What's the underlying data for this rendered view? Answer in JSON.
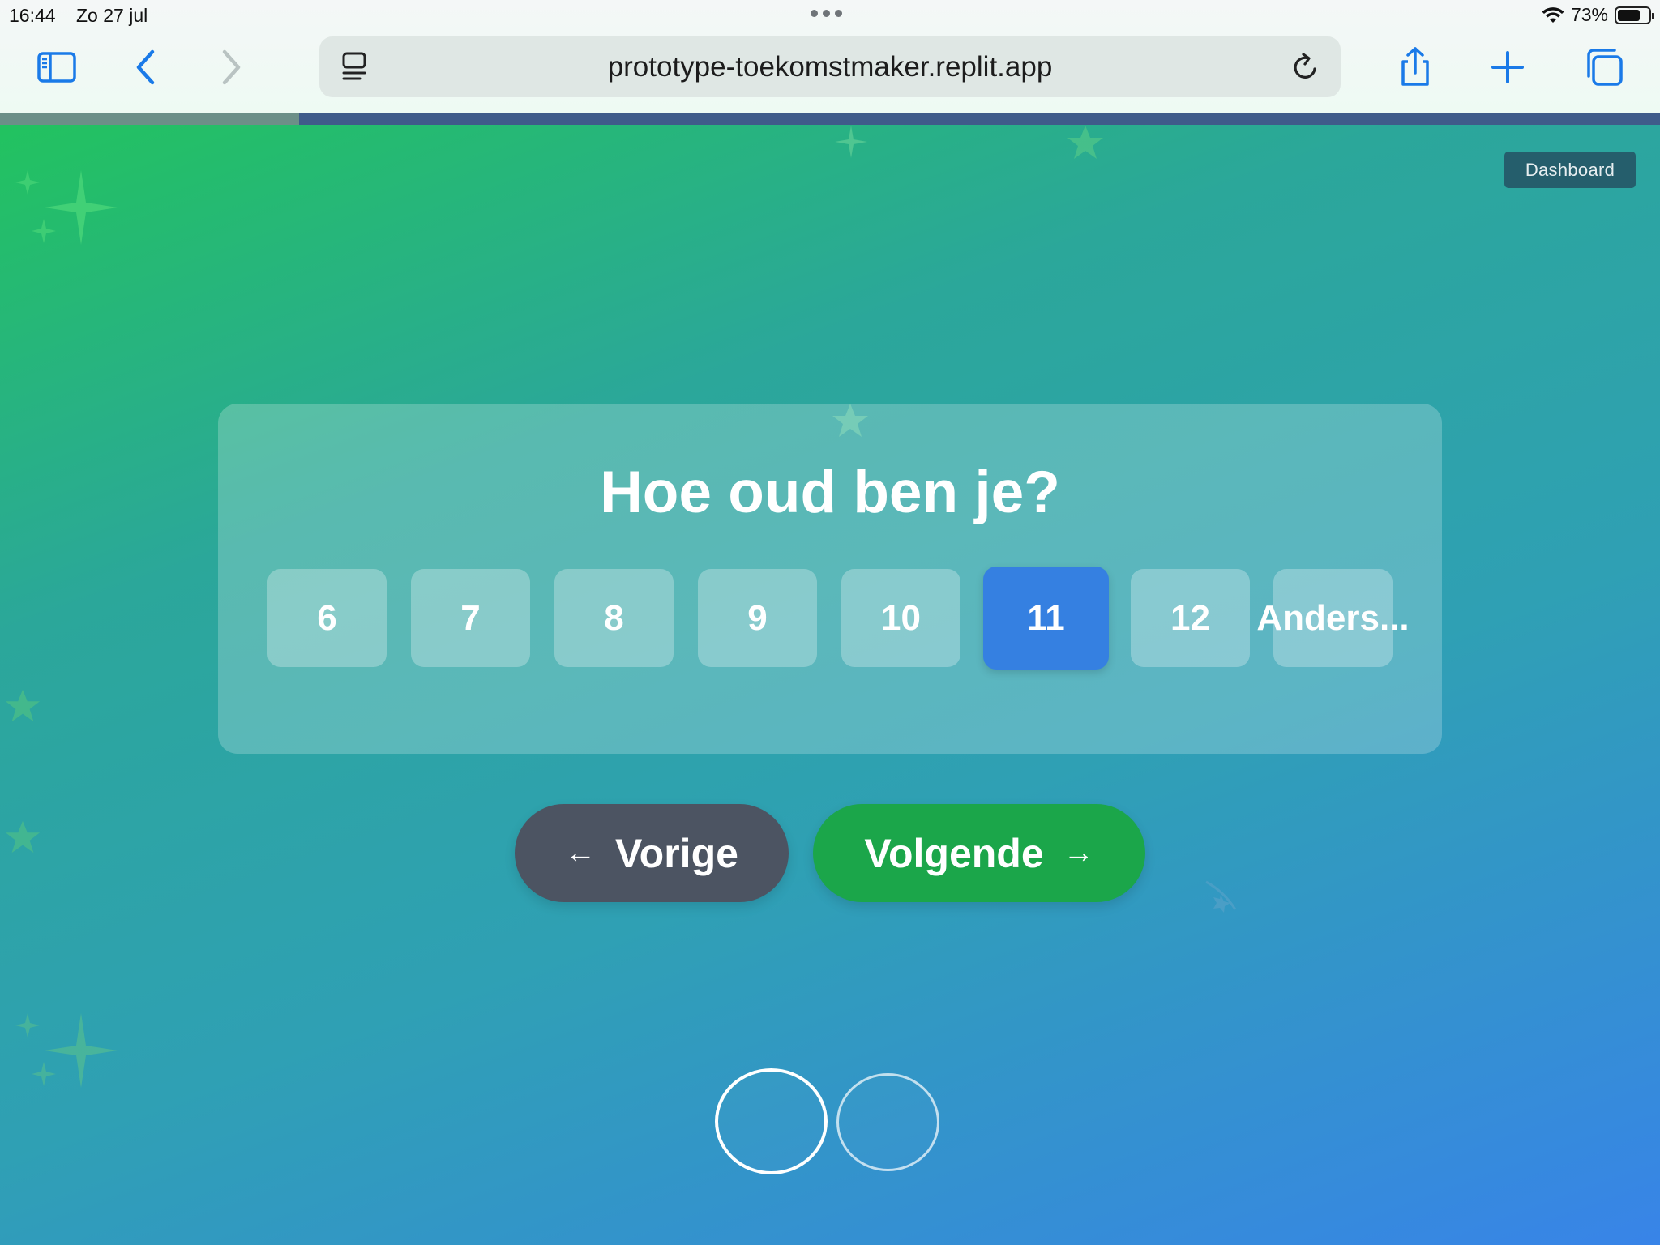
{
  "status_bar": {
    "time": "16:44",
    "date": "Zo 27 jul",
    "battery_percent": "73%",
    "battery_level": 0.73
  },
  "browser": {
    "url": "prototype-toekomstmaker.replit.app",
    "icons": {
      "sidebar": "sidebar-icon",
      "back": "chevron-left-icon",
      "forward": "chevron-right-icon",
      "page_menu": "page-menu-icon",
      "reload": "reload-icon",
      "share": "share-icon",
      "new_tab": "plus-icon",
      "tabs": "tabs-icon"
    },
    "accent_color": "#1a7ae8"
  },
  "page": {
    "progress": 0.18,
    "dashboard_label": "Dashboard",
    "question": "Hoe oud ben je?",
    "options": [
      "6",
      "7",
      "8",
      "9",
      "10",
      "11",
      "12",
      "Anders..."
    ],
    "selected_option": "11",
    "prev_label": "Vorige",
    "next_label": "Volgende",
    "prev_arrow": "←",
    "next_arrow": "→",
    "colors": {
      "selected": "#3580e1",
      "next_button": "#1ba64a",
      "prev_button": "#4c5462"
    }
  }
}
